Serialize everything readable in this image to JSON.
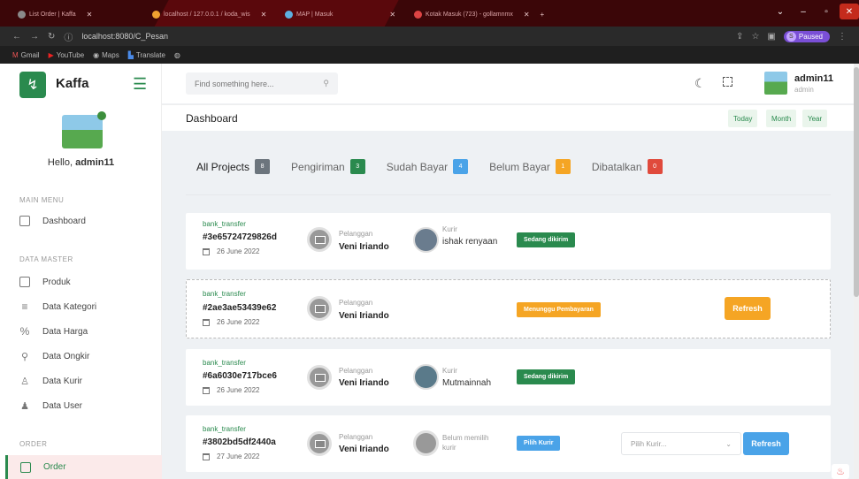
{
  "browser": {
    "tabs": [
      {
        "title": "List Order | Kaffa",
        "icon_color": "#8a8a8a"
      },
      {
        "title": "localhost / 127.0.0.1 / koda_wis",
        "icon_color": "#f0a030"
      },
      {
        "title": "MAP | Masuk",
        "icon_color": "#5db0e0"
      },
      {
        "title": "Kotak Masuk (723) - gollamnmx",
        "icon_color": "#d44"
      }
    ],
    "address": "localhost:8080/C_Pesan",
    "paused_label": "Paused",
    "paused_initial": "S",
    "bookmarks": [
      "Gmail",
      "YouTube",
      "Maps",
      "Translate"
    ]
  },
  "sidebar": {
    "brand": "Kaffa",
    "greeting": "Hello,",
    "username": "admin11",
    "sections": {
      "main": "MAIN MENU",
      "master": "DATA MASTER",
      "order": "ORDER"
    },
    "items": {
      "dashboard": "Dashboard",
      "produk": "Produk",
      "kategori": "Data Kategori",
      "harga": "Data Harga",
      "ongkir": "Data Ongkir",
      "kurir": "Data Kurir",
      "user": "Data User",
      "order": "Order"
    }
  },
  "topbar": {
    "search_placeholder": "Find something here...",
    "user_name": "admin11",
    "user_role": "admin"
  },
  "dashboard": {
    "title": "Dashboard",
    "periods": [
      "Today",
      "Month",
      "Year"
    ]
  },
  "filters": [
    {
      "label": "All Projects",
      "count": "8",
      "color": "#6c757d"
    },
    {
      "label": "Pengiriman",
      "count": "3",
      "color": "#2a8a4e"
    },
    {
      "label": "Sudah Bayar",
      "count": "4",
      "color": "#4aa3e8"
    },
    {
      "label": "Belum Bayar",
      "count": "1",
      "color": "#f5a524"
    },
    {
      "label": "Dibatalkan",
      "count": "0",
      "color": "#e04a3c"
    }
  ],
  "orders": [
    {
      "payment": "bank_transfer",
      "id": "#3e65724729826d",
      "date": "26 June 2022",
      "customer_label": "Pelanggan",
      "customer": "Veni Iriando",
      "courier_label": "Kurir",
      "courier": "ishak renyaan",
      "status": "Sedang dikirim",
      "status_color": "#2a8a4e"
    },
    {
      "payment": "bank_transfer",
      "id": "#2ae3ae53439e62",
      "date": "26 June 2022",
      "customer_label": "Pelanggan",
      "customer": "Veni Iriando",
      "status": "Menunggu Pembayaran",
      "status_color": "#f5a524",
      "action": "Refresh"
    },
    {
      "payment": "bank_transfer",
      "id": "#6a6030e717bce6",
      "date": "26 June 2022",
      "customer_label": "Pelanggan",
      "customer": "Veni Iriando",
      "courier_label": "Kurir",
      "courier": "Mutmainnah",
      "status": "Sedang dikirim",
      "status_color": "#2a8a4e"
    },
    {
      "payment": "bank_transfer",
      "id": "#3802bd5df2440a",
      "date": "27 June 2022",
      "customer_label": "Pelanggan",
      "customer": "Veni Iriando",
      "courier_label": "Belum memilih kurir",
      "status": "Pilih Kurir",
      "status_color": "#4aa3e8",
      "select_placeholder": "Pilih Kurir...",
      "action": "Refresh"
    }
  ],
  "colors": {
    "accent": "#2a8a4e",
    "warning": "#f5a524",
    "info": "#4aa3e8"
  }
}
